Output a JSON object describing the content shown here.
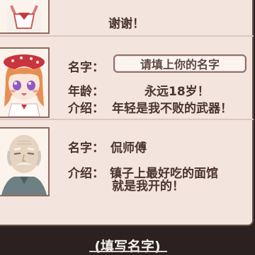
{
  "dialog": {
    "top_message": "谢谢！",
    "player": {
      "name_label": "名字：",
      "name_placeholder": "请填上你的名字",
      "age_label": "年龄：",
      "age_value": "永远18岁！",
      "intro_label": "介绍：",
      "intro_value": "年轻是我不败的武器！"
    },
    "npc": {
      "name_label": "名字：",
      "name_value": "侃师傅",
      "intro_label": "介绍：",
      "intro_line1": "镇子上最好吃的面馆",
      "intro_line2": "就是我开的！"
    }
  },
  "footer": {
    "title": "(填写名字)"
  }
}
